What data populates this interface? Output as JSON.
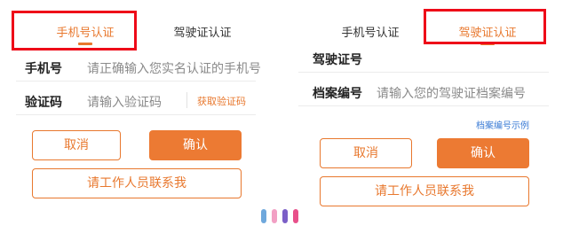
{
  "left": {
    "tabs": [
      {
        "label": "手机号认证",
        "active": true
      },
      {
        "label": "驾驶证认证",
        "active": false
      }
    ],
    "phone_label": "手机号",
    "phone_placeholder": "请正确输入您实名认证的手机号",
    "code_label": "验证码",
    "code_placeholder": "请输入验证码",
    "get_code_label": "获取验证码",
    "cancel_label": "取消",
    "confirm_label": "确认",
    "contact_label": "请工作人员联系我"
  },
  "right": {
    "tabs": [
      {
        "label": "手机号认证",
        "active": false
      },
      {
        "label": "驾驶证认证",
        "active": true
      }
    ],
    "license_label": "驾驶证号",
    "file_label": "档案编号",
    "file_placeholder": "请输入您的驾驶证档案编号",
    "file_example_link": "档案编号示例",
    "cancel_label": "取消",
    "confirm_label": "确认",
    "contact_label": "请工作人员联系我"
  },
  "colors": {
    "accent": "#e8782e",
    "highlight_box": "#ee0a18",
    "link": "#3a7bd5"
  },
  "logo_dots": [
    "#6fa8dc",
    "#f2a0c4",
    "#7b5fc7",
    "#e8508a"
  ]
}
